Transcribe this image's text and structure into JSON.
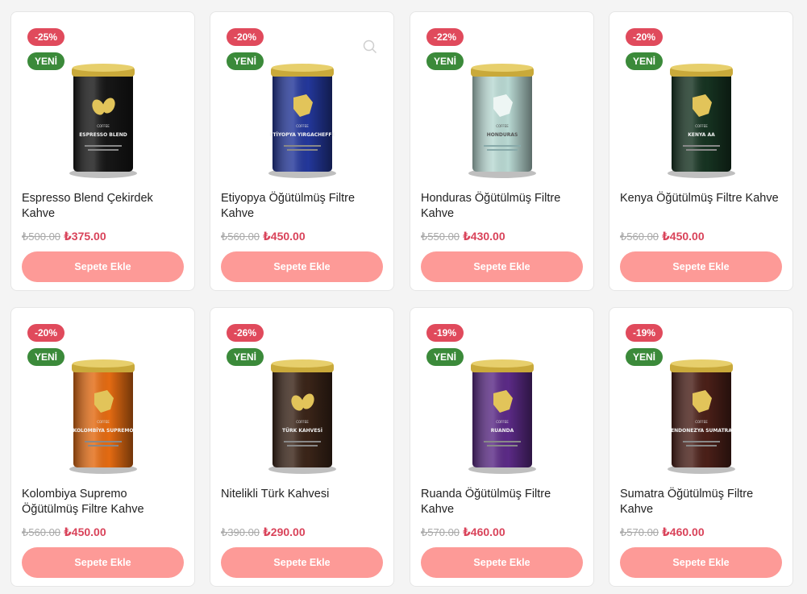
{
  "products": [
    {
      "title": "Espresso Blend Çekirdek Kahve",
      "discount": "-25%",
      "badge": "YENİ",
      "old_price": "₺500.00",
      "price": "₺375.00",
      "button": "Sepete Ekle",
      "can_color": "#161616",
      "can_label": "ESPRESSO BLEND",
      "icon": "coffee-bean-icon"
    },
    {
      "title": "Etiyopya Öğütülmüş Filtre Kahve",
      "discount": "-20%",
      "badge": "YENİ",
      "old_price": "₺560.00",
      "price": "₺450.00",
      "button": "Sepete Ekle",
      "can_color": "#23379a",
      "can_label": "ETİYOPYA YIRGACHEFFE",
      "icon": "ethiopia-map-icon"
    },
    {
      "title": "Honduras Öğütülmüş Filtre Kahve",
      "discount": "-22%",
      "badge": "YENİ",
      "old_price": "₺550.00",
      "price": "₺430.00",
      "button": "Sepete Ekle",
      "can_color": "#b9d9d3",
      "can_label": "HONDURAS",
      "icon": "honduras-map-icon"
    },
    {
      "title": "Kenya Öğütülmüş Filtre Kahve",
      "discount": "-20%",
      "badge": "YENİ",
      "old_price": "₺560.00",
      "price": "₺450.00",
      "button": "Sepete Ekle",
      "can_color": "#163321",
      "can_label": "KENYA AA",
      "icon": "kenya-map-icon"
    },
    {
      "title": "Kolombiya Supremo Öğütülmüş Filtre Kahve",
      "discount": "-20%",
      "badge": "YENİ",
      "old_price": "₺560.00",
      "price": "₺450.00",
      "button": "Sepete Ekle",
      "can_color": "#e46b12",
      "can_label": "KOLOMBİYA SUPREMO",
      "icon": "colombia-map-icon"
    },
    {
      "title": "Nitelikli Türk Kahvesi",
      "discount": "-26%",
      "badge": "YENİ",
      "old_price": "₺390.00",
      "price": "₺290.00",
      "button": "Sepete Ekle",
      "can_color": "#3a2418",
      "can_label": "TÜRK KAHVESİ",
      "icon": "coffee-bean-icon"
    },
    {
      "title": "Ruanda Öğütülmüş Filtre Kahve",
      "discount": "-19%",
      "badge": "YENİ",
      "old_price": "₺570.00",
      "price": "₺460.00",
      "button": "Sepete Ekle",
      "can_color": "#5b2a86",
      "can_label": "RUANDA",
      "icon": "rwanda-map-icon"
    },
    {
      "title": "Sumatra Öğütülmüş Filtre Kahve",
      "discount": "-19%",
      "badge": "YENİ",
      "old_price": "₺570.00",
      "price": "₺460.00",
      "button": "Sepete Ekle",
      "can_color": "#4a1f18",
      "can_label": "ENDONEZYA SUMATRA",
      "icon": "indonesia-map-icon"
    }
  ],
  "colors": {
    "discount_badge": "#e04a5c",
    "new_badge": "#3b8a3a",
    "price": "#d9435a",
    "button": "#fd9a97",
    "can_lid": "#c9a93a"
  }
}
